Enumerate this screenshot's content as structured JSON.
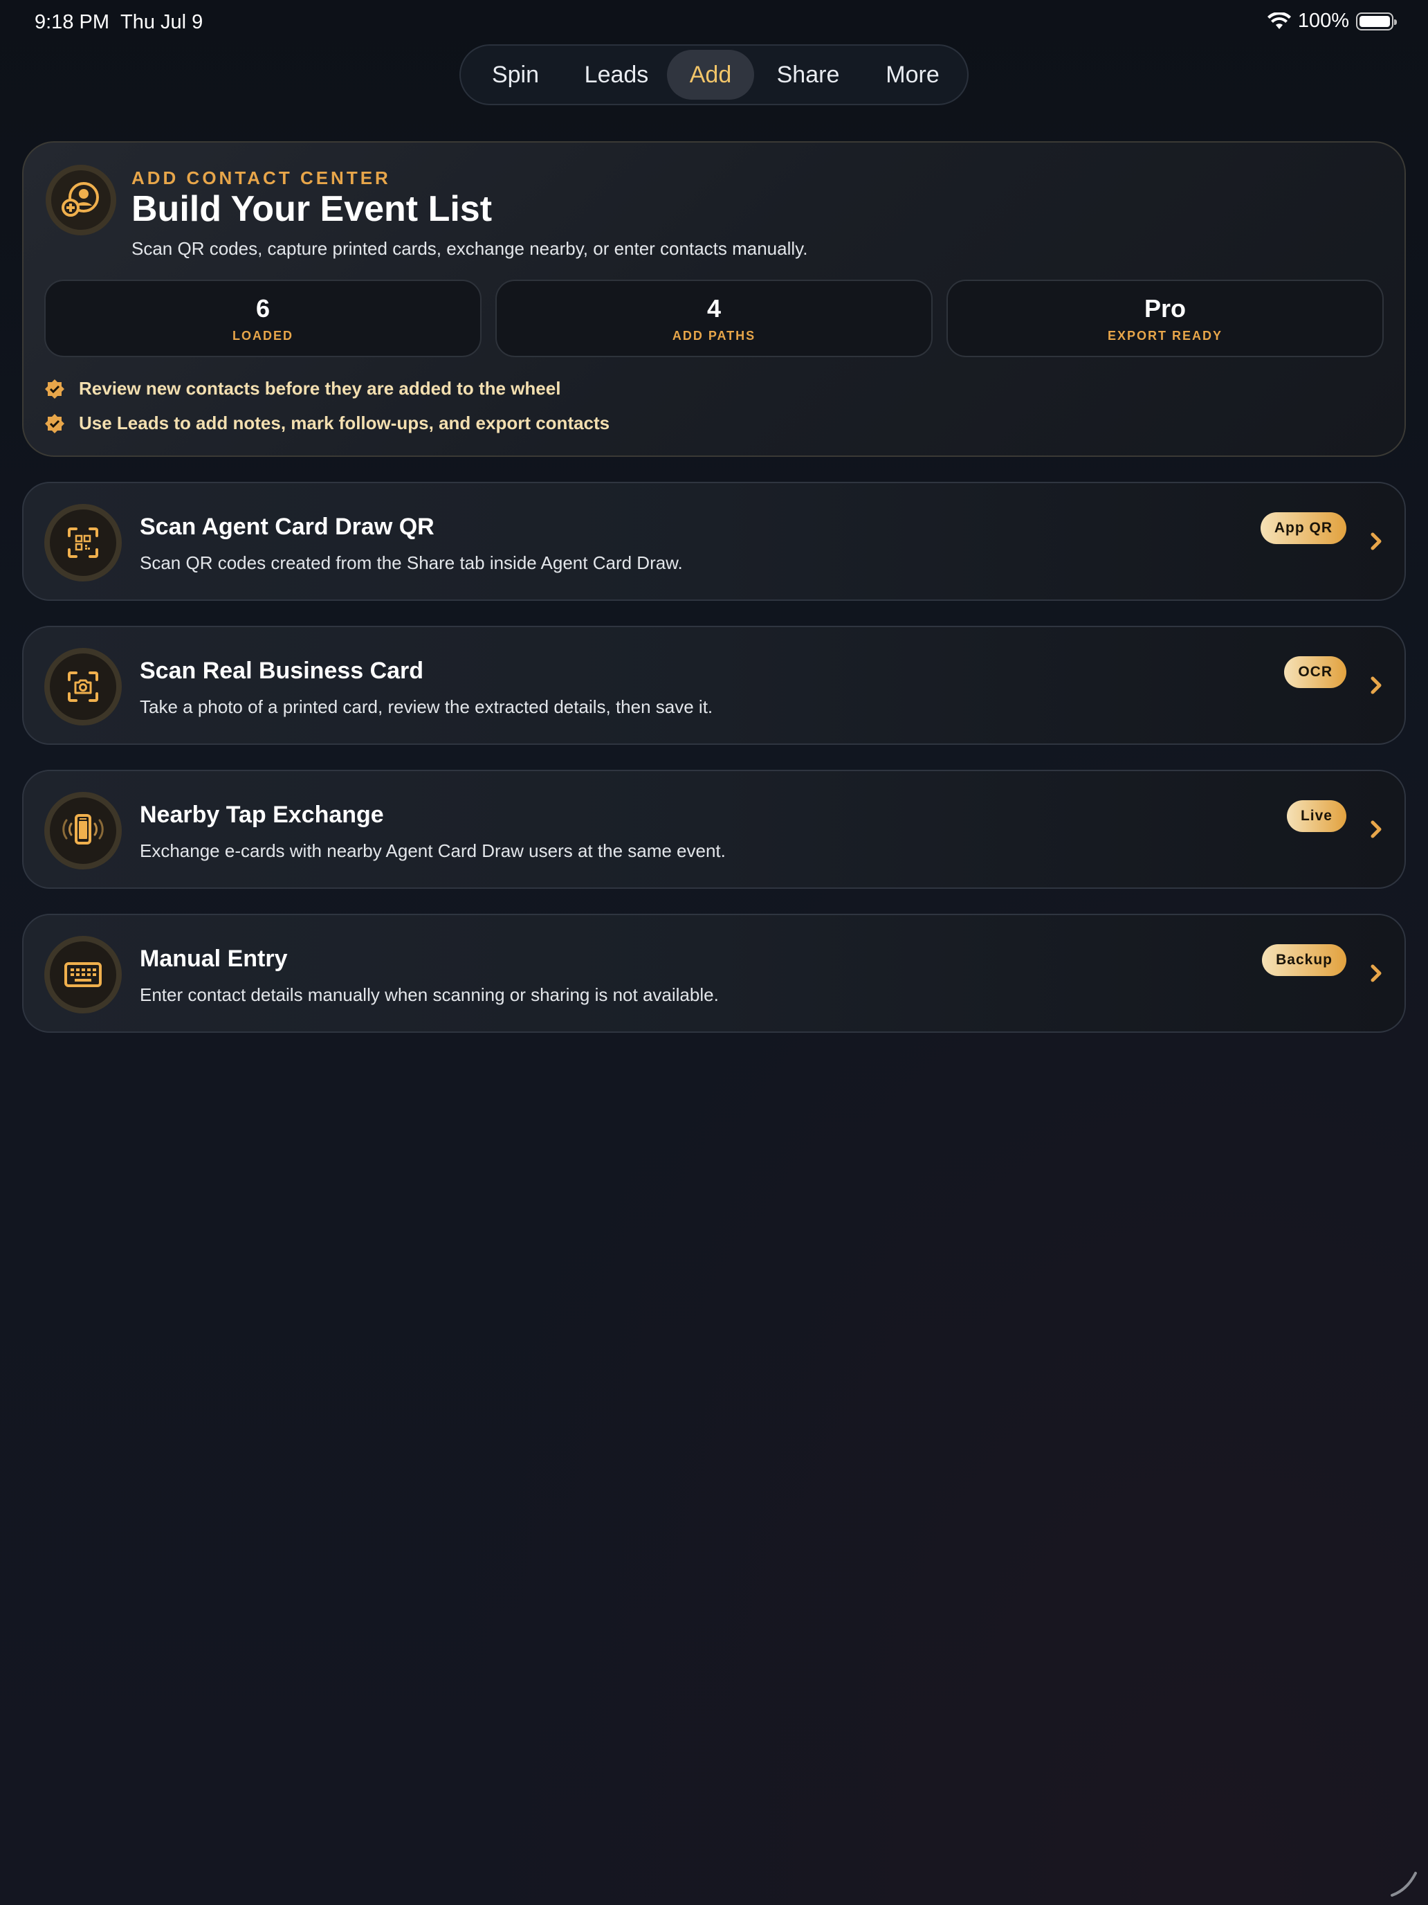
{
  "status_bar": {
    "time": "9:18 PM",
    "date": "Thu Jul 9",
    "battery": "100%"
  },
  "nav": {
    "tabs": [
      "Spin",
      "Leads",
      "Add",
      "Share",
      "More"
    ],
    "active": "Add"
  },
  "hero": {
    "eyebrow": "ADD CONTACT CENTER",
    "title": "Build Your Event List",
    "subtitle": "Scan QR codes, capture printed cards, exchange nearby, or enter contacts manually.",
    "stats": [
      {
        "value": "6",
        "label": "LOADED"
      },
      {
        "value": "4",
        "label": "ADD PATHS"
      },
      {
        "value": "Pro",
        "label": "EXPORT READY"
      }
    ],
    "bullets": [
      "Review new contacts before they are added to the wheel",
      "Use Leads to add notes, mark follow-ups, and export contacts"
    ]
  },
  "actions": [
    {
      "icon": "qr-scan-icon",
      "title": "Scan Agent Card Draw QR",
      "description": "Scan QR codes created from the Share tab inside Agent Card Draw.",
      "badge": "App QR"
    },
    {
      "icon": "camera-scan-icon",
      "title": "Scan Real Business Card",
      "description": "Take a photo of a printed card, review the extracted details, then save it.",
      "badge": "OCR"
    },
    {
      "icon": "phone-waves-icon",
      "title": "Nearby Tap Exchange",
      "description": "Exchange e-cards with nearby Agent Card Draw users at the same event.",
      "badge": "Live"
    },
    {
      "icon": "keyboard-icon",
      "title": "Manual Entry",
      "description": "Enter contact details manually when scanning or sharing is not available.",
      "badge": "Backup"
    }
  ],
  "colors": {
    "accent": "#e8a64a",
    "active_tab_text": "#f2c569",
    "background": "#111620"
  }
}
